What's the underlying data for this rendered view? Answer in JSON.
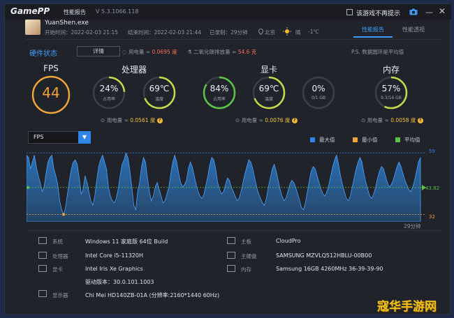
{
  "titlebar": {
    "logo": "GamePP",
    "tab": "性能报告",
    "version": "V 5.3.1066.118",
    "no_popup_label": "该游戏不再提示",
    "minimize": "—",
    "close": "✕"
  },
  "session": {
    "app_name": "YuanShen.exe",
    "start_time": "开始时间：2022-02-03 21:15",
    "end_time": "结束时间：2022-02-03 21:44",
    "duration": "已录制：29分钟",
    "location": "北京",
    "weather": "晴",
    "temperature": "-1℃"
  },
  "tabs": [
    {
      "label": "性能报告",
      "active": true
    },
    {
      "label": "性能透视",
      "active": false
    }
  ],
  "summary": {
    "title": "硬件状态",
    "detail_button": "详情",
    "power_total_prefix": "用电量 ≈",
    "power_total_value": "0.0695 度",
    "co2_prefix": "二氧化碳排放量 ≈",
    "co2_value": "54.6 克",
    "hint": "P.S. 数据圆环是平均值"
  },
  "fps": {
    "label": "FPS",
    "value": "44"
  },
  "cpu": {
    "title": "处理器",
    "usage": {
      "value": "24%",
      "label": "占用率",
      "fraction": 0.24
    },
    "temp": {
      "value": "69℃",
      "label": "温度",
      "fraction": 0.69
    },
    "power_prefix": "用电量 ≈",
    "power_value": "0.0561 度"
  },
  "gpu": {
    "title": "显卡",
    "usage": {
      "value": "84%",
      "label": "占用率",
      "fraction": 0.84
    },
    "temp": {
      "value": "69℃",
      "label": "温度",
      "fraction": 0.69
    },
    "vram": {
      "value": "0%",
      "label": "0/1 GB",
      "fraction": 0
    },
    "power_prefix": "用电量 ≈",
    "power_value": "0.0076 度"
  },
  "memory": {
    "title": "内存",
    "usage": {
      "value": "57%",
      "label": "9.3/16 GB",
      "fraction": 0.57
    },
    "power_prefix": "用电量 ≈",
    "power_value": "0.0058 度"
  },
  "chart_controls": {
    "metric": "FPS",
    "legend": [
      {
        "label": "最大值",
        "color": "#2f86e8"
      },
      {
        "label": "最小值",
        "color": "#f2a33a"
      },
      {
        "label": "平均值",
        "color": "#5bc24a"
      }
    ],
    "colors": {
      "fill": "#2e7fd1",
      "max": "#2f86e8",
      "min": "#f2a33a",
      "avg": "#5bc24a"
    }
  },
  "chart_data": {
    "type": "area",
    "y_max": 59,
    "y_min": 32,
    "y_avg": 43.82,
    "y_max_label": "59",
    "y_min_label": "32",
    "y_avg_label": "43.82",
    "x_end_label": "29分钟",
    "ylim": [
      30,
      60
    ],
    "values": [
      58,
      57,
      52,
      55,
      58,
      53,
      49,
      46,
      42,
      44,
      50,
      55,
      57,
      58,
      52,
      49,
      45,
      38,
      34,
      32,
      35,
      41,
      47,
      52,
      55,
      56,
      54,
      48,
      41,
      43,
      49,
      46,
      42,
      38,
      36,
      40,
      47,
      53,
      56,
      58,
      55,
      52,
      44,
      40,
      38,
      37,
      39,
      43,
      49,
      54,
      56,
      59,
      57,
      51,
      44,
      36,
      34,
      42,
      46,
      53,
      57,
      55,
      48,
      42,
      38,
      40,
      44,
      46,
      43,
      40,
      37,
      38,
      41,
      44,
      50,
      55,
      58,
      55,
      50,
      46,
      44,
      45,
      47,
      52,
      55,
      53,
      49,
      45,
      42,
      40,
      39,
      41,
      45,
      49,
      54,
      57,
      56,
      52,
      46,
      43,
      41,
      42,
      45,
      48,
      47,
      44,
      42,
      40,
      38,
      39,
      42,
      46,
      50,
      53,
      56,
      55,
      52,
      48,
      44,
      41,
      39,
      37,
      36,
      39,
      44,
      48,
      52,
      54,
      51,
      47,
      43,
      40,
      38,
      39,
      42,
      45,
      47,
      46,
      44,
      41,
      38,
      35,
      34,
      37,
      42,
      47,
      51,
      53,
      52,
      49,
      46,
      43,
      41,
      40,
      42,
      45,
      49,
      53,
      56,
      58,
      54,
      49,
      45,
      42,
      39,
      38,
      40,
      44,
      48,
      52,
      55,
      57,
      55,
      50,
      46,
      43,
      40,
      39,
      41,
      44,
      48,
      51,
      53,
      52,
      49,
      46,
      44,
      45,
      47,
      50,
      53,
      55,
      53,
      50,
      47,
      45,
      43,
      42,
      44,
      47,
      51,
      55,
      57
    ]
  },
  "specs": [
    {
      "label": "系统",
      "value": "Windows 11 家庭版 64位   Build"
    },
    {
      "label": "处理器",
      "value": "Intel Core i5-11320H"
    },
    {
      "label": "显卡",
      "value": "Intel Iris Xe Graphics"
    },
    {
      "label": "",
      "value": "驱动版本：30.0.101.1003"
    },
    {
      "label": "显示器",
      "value": "Chi Mei HD140ZB-01A (分辨率:2160*1440 60Hz)"
    }
  ],
  "specs_right": [
    {
      "label": "主板",
      "value": "CloudPro"
    },
    {
      "label": "主硬盘",
      "value": "SAMSUNG MZVLQ512HBLU-00B00"
    },
    {
      "label": "内存",
      "value": "Samsung 16GB 4260MHz 36-39-39-90"
    }
  ],
  "watermark": "寇华手游网"
}
